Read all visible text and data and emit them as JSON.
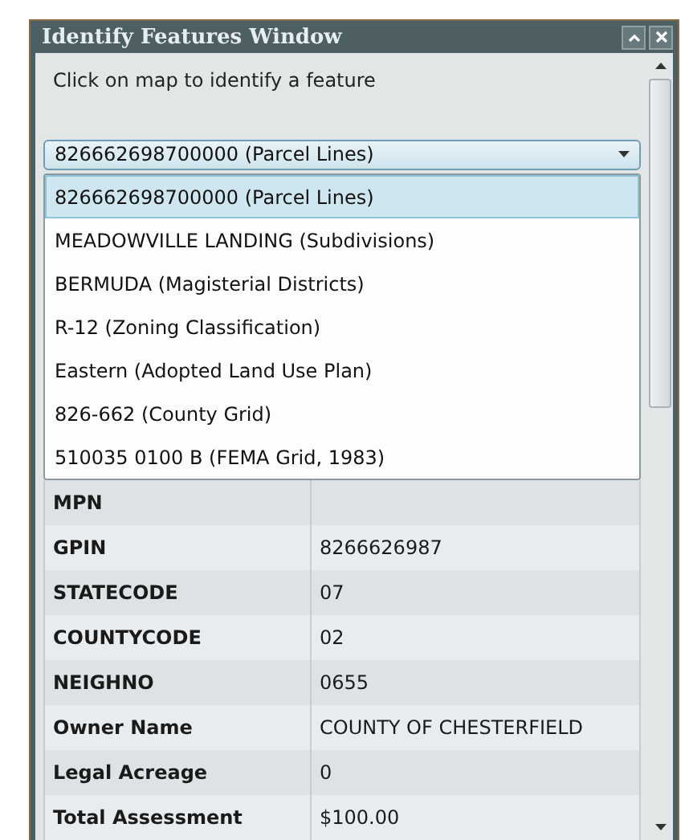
{
  "window": {
    "title": "Identify Features Window"
  },
  "instruction": "Click on map to identify a feature",
  "dropdown": {
    "value": "826662698700000 (Parcel Lines)",
    "expanded": true,
    "options": [
      {
        "label": "826662698700000 (Parcel Lines)",
        "selected": true
      },
      {
        "label": "MEADOWVILLE LANDING (Subdivisions)",
        "selected": false
      },
      {
        "label": "BERMUDA (Magisterial Districts)",
        "selected": false
      },
      {
        "label": "R-12 (Zoning Classification)",
        "selected": false
      },
      {
        "label": "Eastern (Adopted Land Use Plan)",
        "selected": false
      },
      {
        "label": "826-662 (County Grid)",
        "selected": false
      },
      {
        "label": "510035 0100 B (FEMA Grid, 1983)",
        "selected": false
      }
    ]
  },
  "table": {
    "rows": [
      {
        "field": "MPN"
      },
      {
        "field": "GPIN",
        "value": "8266626987"
      },
      {
        "field": "STATECODE",
        "value": "07"
      },
      {
        "field": "COUNTYCODE",
        "value": "02"
      },
      {
        "field": "NEIGHNO",
        "value": "0655"
      },
      {
        "field": "Owner Name",
        "value": "COUNTY OF CHESTERFIELD"
      },
      {
        "field": "Legal Acreage",
        "value": "0"
      },
      {
        "field": "Total Assessment",
        "value": "$100.00"
      }
    ]
  }
}
